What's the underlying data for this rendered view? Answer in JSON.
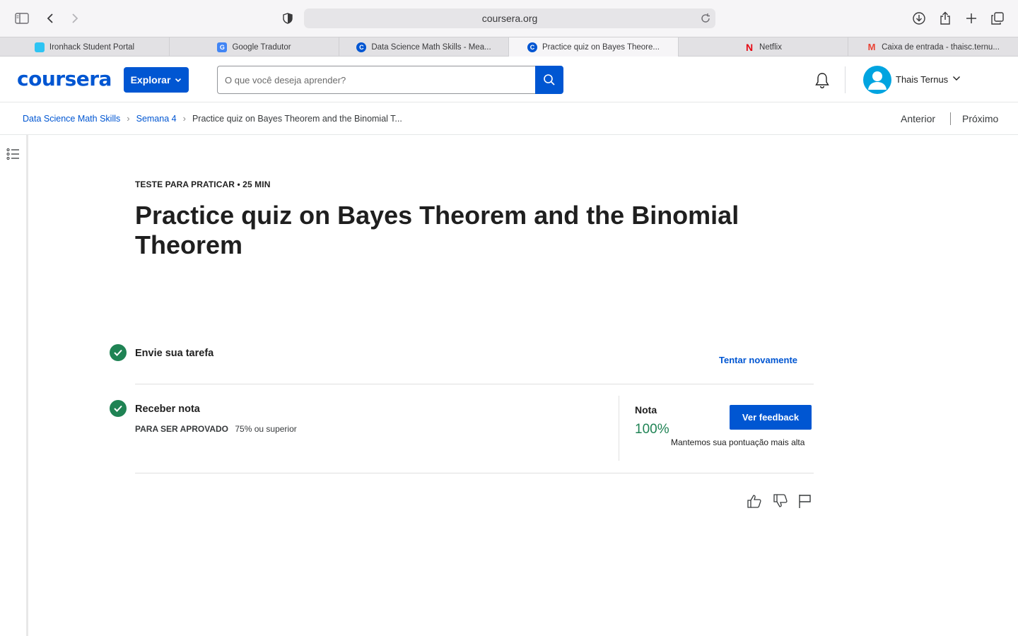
{
  "browser": {
    "url": "coursera.org",
    "tabs": [
      {
        "label": "Ironhack Student Portal",
        "color": "#2ec4f3",
        "glyph": "",
        "active": false
      },
      {
        "label": "Google Tradutor",
        "color": "#4285f4",
        "glyph": "G",
        "active": false
      },
      {
        "label": "Data Science Math Skills - Mea...",
        "color": "#0056d2",
        "glyph": "C",
        "active": false
      },
      {
        "label": "Practice quiz on Bayes Theore...",
        "color": "#0056d2",
        "glyph": "C",
        "active": true
      },
      {
        "label": "Netflix",
        "color": "#e50914",
        "glyph": "N",
        "active": false
      },
      {
        "label": "Caixa de entrada - thaisc.ternu...",
        "color": "#ea4335",
        "glyph": "M",
        "active": false
      }
    ]
  },
  "header": {
    "logo": "coursera",
    "explore_label": "Explorar",
    "search_placeholder": "O que você deseja aprender?",
    "user_name": "Thais Ternus"
  },
  "breadcrumb": {
    "course": "Data Science Math Skills",
    "week": "Semana 4",
    "current": "Practice quiz on Bayes Theorem and the Binomial T...",
    "prev": "Anterior",
    "next": "Próximo"
  },
  "quiz": {
    "eyebrow": "TESTE PARA PRATICAR • 25 MIN",
    "title": "Practice quiz on Bayes Theorem and the Binomial Theorem"
  },
  "steps": {
    "submit_title": "Envie sua tarefa",
    "retry_label": "Tentar novamente",
    "grade_title": "Receber nota",
    "pass_label": "PARA SER APROVADO",
    "pass_value": "75% ou superior",
    "grade_label": "Nota",
    "grade_value": "100%",
    "feedback_label": "Ver feedback",
    "kept_note": "Mantemos sua pontuação mais alta"
  },
  "colors": {
    "brand": "#0056d2",
    "success": "#1f8354"
  }
}
